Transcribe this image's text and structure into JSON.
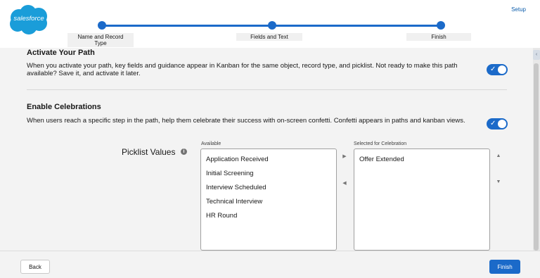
{
  "header": {
    "logo_text": "salesforce",
    "setup_label": "Setup",
    "brand_color": "#1b6ac9",
    "steps": [
      {
        "label": "Name and Record Type"
      },
      {
        "label": "Fields and Text"
      },
      {
        "label": "Finish"
      }
    ]
  },
  "activate_path": {
    "title": "Activate Your Path",
    "description": "When you activate your path, key fields and guidance appear in Kanban for the same object, record type, and picklist. Not ready to make this path available? Save it, and activate it later.",
    "toggle_on": true
  },
  "celebrations": {
    "title": "Enable Celebrations",
    "description": "When users reach a specific step in the path, help them celebrate their success with on-screen confetti. Confetti appears in paths and kanban views.",
    "toggle_on": true
  },
  "picklist": {
    "label": "Picklist Values",
    "info_icon": "info-icon",
    "available_caption": "Available",
    "selected_caption": "Selected for Celebration",
    "available": [
      "Application Received",
      "Initial Screening",
      "Interview Scheduled",
      "Technical Interview",
      "HR Round"
    ],
    "selected": [
      "Offer Extended"
    ]
  },
  "footer": {
    "back_label": "Back",
    "finish_label": "Finish"
  }
}
